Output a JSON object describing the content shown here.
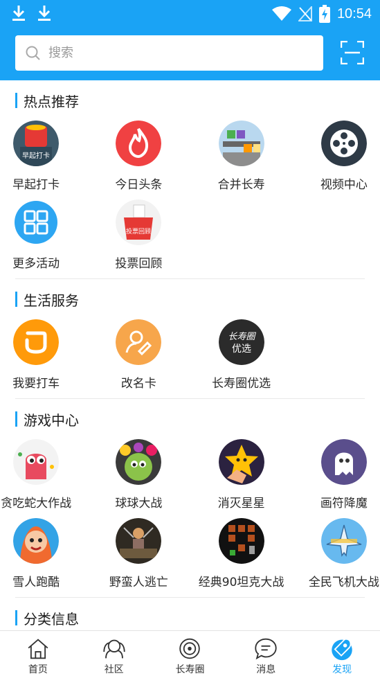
{
  "status_bar": {
    "time": "10:54"
  },
  "search": {
    "placeholder": "搜索"
  },
  "sections": {
    "hot": {
      "title": "热点推荐",
      "items": [
        "早起打卡",
        "今日头条",
        "合并长寿",
        "视频中心",
        "更多活动",
        "投票回顾"
      ],
      "icon_text": {
        "checkin": "早起打卡",
        "vote": "投票回顾"
      }
    },
    "life": {
      "title": "生活服务",
      "items": [
        "我要打车",
        "改名卡",
        "长寿圈优选"
      ],
      "icon_text": {
        "line1": "长寿圈",
        "line2": "优选"
      }
    },
    "games": {
      "title": "游戏中心",
      "items": [
        "贪吃蛇大作战",
        "球球大战",
        "消灭星星",
        "画符降魔",
        "雪人跑酷",
        "野蛮人逃亡",
        "经典90坦克大战",
        "全民飞机大战"
      ]
    },
    "category": {
      "title": "分类信息"
    }
  },
  "tabbar": {
    "tabs": [
      "首页",
      "社区",
      "长寿圈",
      "消息",
      "发现"
    ],
    "active": "发现"
  },
  "colors": {
    "accent": "#1aa3f5",
    "toutiao_red": "#f04142",
    "didi_orange": "#ff8c00"
  }
}
